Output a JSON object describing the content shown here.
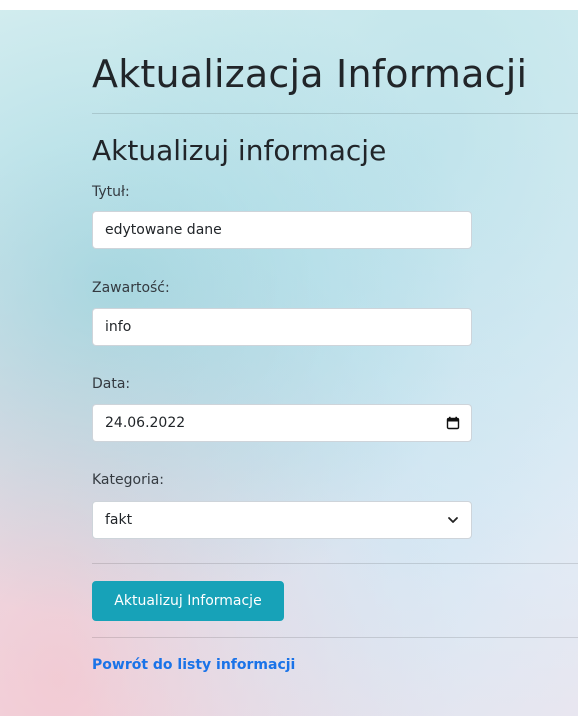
{
  "page": {
    "title": "Aktualizacja Informacji"
  },
  "form": {
    "heading": "Aktualizuj informacje",
    "fields": {
      "title": {
        "label": "Tytuł:",
        "value": "edytowane dane"
      },
      "content": {
        "label": "Zawartość:",
        "value": "info"
      },
      "date": {
        "label": "Data:",
        "value": "24.06.2022",
        "icon": "calendar-icon"
      },
      "category": {
        "label": "Kategoria:",
        "selected": "fakt",
        "icon": "chevron-down-icon"
      }
    },
    "submit_label": "Aktualizuj Informacje",
    "back_link_label": "Powrót do listy informacji"
  },
  "colors": {
    "primary_button": "#17a2b8",
    "link": "#1a73e8"
  }
}
